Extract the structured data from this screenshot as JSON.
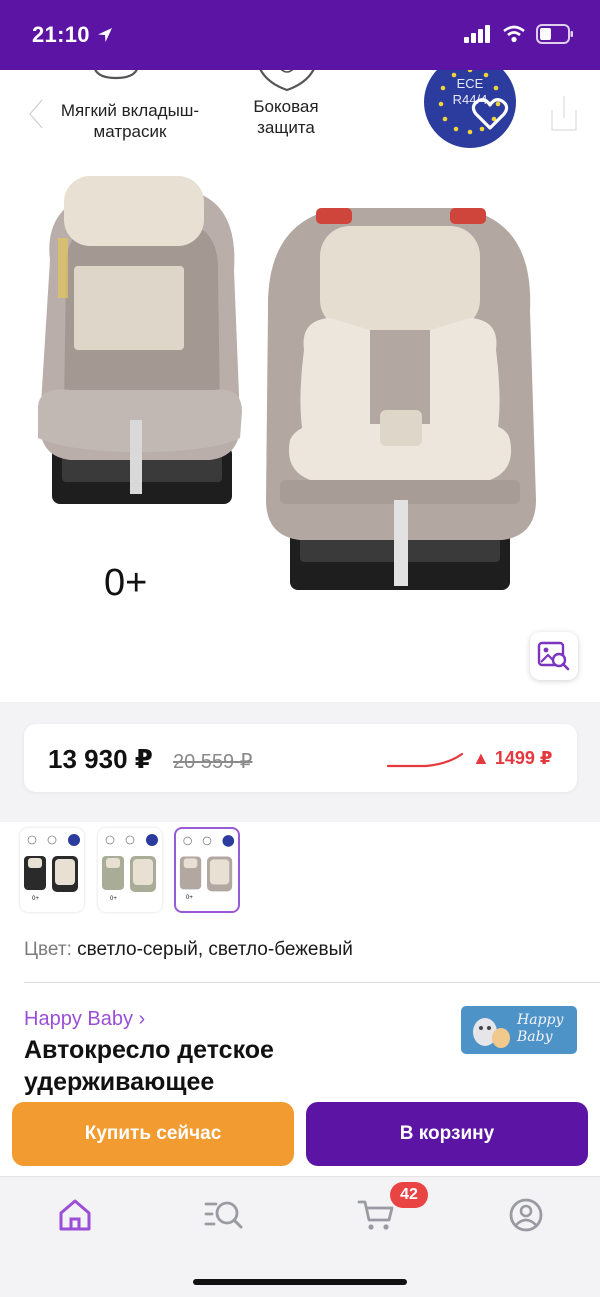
{
  "status_bar": {
    "time": "21:10"
  },
  "gallery": {
    "features": [
      "Мягкий вкладыш-матрасик",
      "Боковая защита"
    ],
    "ece_badge": [
      "ECE",
      "R44/4"
    ],
    "age_label": "0+"
  },
  "price": {
    "current": "13 930 ₽",
    "old": "20 559 ₽",
    "delta": "▲ 1499 ₽"
  },
  "thumbnails": [
    {
      "caption": "0+",
      "selected": false
    },
    {
      "caption": "0+",
      "selected": false
    },
    {
      "caption": "0+",
      "selected": true
    }
  ],
  "color": {
    "label": "Цвет:",
    "value": "светло-серый, светло-бежевый"
  },
  "product": {
    "brand": "Happy Baby ›",
    "brand_logo_text": "Happy Baby",
    "title": "Автокресло детское удерживающее"
  },
  "actions": {
    "buy_now": "Купить сейчас",
    "add_to_cart": "В корзину"
  },
  "tabbar": {
    "cart_count": "42",
    "items": [
      "home-icon",
      "search-icon",
      "cart-icon",
      "profile-icon"
    ]
  },
  "colors": {
    "brand_purple": "#5b14a3",
    "buy_orange": "#f29b30",
    "price_up_red": "#e5393f",
    "brand_link": "#9a4fd6"
  }
}
